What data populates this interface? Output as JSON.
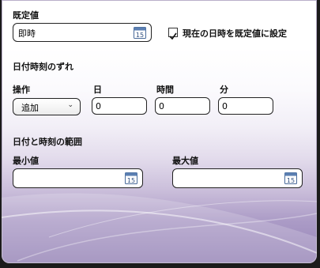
{
  "default_value": {
    "heading": "既定値",
    "value": "即時",
    "calendar_number": "15"
  },
  "use_current_checkbox": {
    "label": "現在の日時を既定値に設定",
    "checked": true
  },
  "offset": {
    "heading": "日付時刻のずれ",
    "operation_label": "操作",
    "operation_value": "追加",
    "day_label": "日",
    "day_value": "0",
    "hour_label": "時間",
    "hour_value": "0",
    "minute_label": "分",
    "minute_value": "0"
  },
  "range": {
    "heading": "日付と時刻の範囲",
    "min_label": "最小値",
    "min_value": "",
    "max_label": "最大値",
    "max_value": "",
    "calendar_number": "15"
  },
  "colors": {
    "accent_purple": "#9583b6",
    "calendar_blue": "#5b7fb2"
  },
  "icons": {
    "calendar": "calendar-icon",
    "checkmark": "checkmark-icon",
    "dropdown": "chevron-down-icon"
  }
}
